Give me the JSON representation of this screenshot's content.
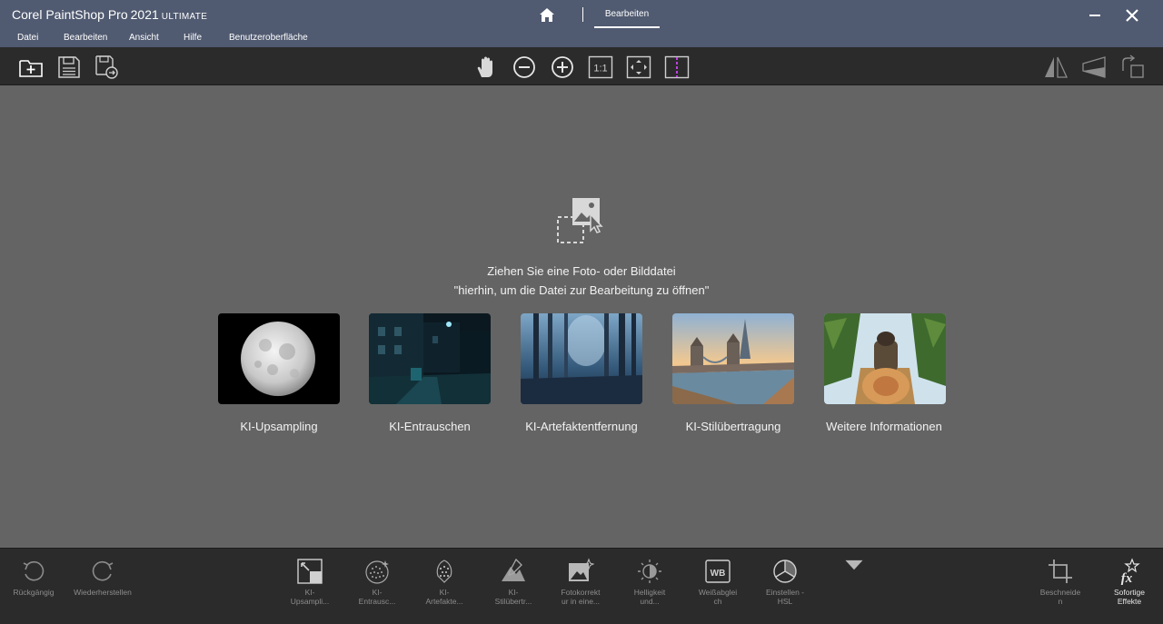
{
  "titlebar": {
    "app_name": "Corel PaintShop Pro",
    "year": "2021",
    "edition": "ULTIMATE",
    "active_tab": "Bearbeiten"
  },
  "menu": {
    "items": [
      "Datei",
      "Bearbeiten",
      "Ansicht",
      "Hilfe",
      "Benutzeroberfläche"
    ]
  },
  "toolbar": {
    "left": [
      "new-icon",
      "save-icon",
      "save-as-icon"
    ],
    "center": [
      "pan-icon",
      "zoom-out-icon",
      "zoom-in-icon",
      "actual-size-icon",
      "fit-icon",
      "compare-icon"
    ],
    "right": [
      "flip-icon",
      "perspective-icon",
      "rotate-icon"
    ],
    "actual_size_text": "1:1"
  },
  "workspace": {
    "drop_line1": "Ziehen Sie eine Foto- oder Bilddatei",
    "drop_line2": "\"hierhin, um die Datei zur Bearbeitung zu öffnen\"",
    "cards": [
      {
        "label": "KI-Upsampling"
      },
      {
        "label": "KI-Entrauschen"
      },
      {
        "label": "KI-Artefaktentfernung"
      },
      {
        "label": "KI-Stilübertragung"
      },
      {
        "label": "Weitere Informationen"
      }
    ]
  },
  "bottombar": {
    "undo": {
      "line1": "Rückgängig"
    },
    "redo": {
      "line1": "Wiederherstellen"
    },
    "tools": [
      {
        "line1": "KI-",
        "line2": "Upsampli..."
      },
      {
        "line1": "KI-",
        "line2": "Entrausc..."
      },
      {
        "line1": "KI-",
        "line2": "Artefakte..."
      },
      {
        "line1": "KI-",
        "line2": "Stilübertr..."
      },
      {
        "line1": "Fotokorrekt",
        "line2": "ur in eine..."
      },
      {
        "line1": "Helligkeit",
        "line2": "und..."
      },
      {
        "line1": "Weißabglei",
        "line2": "ch"
      },
      {
        "line1": "Einstellen -",
        "line2": "HSL"
      }
    ],
    "wb_text": "WB",
    "crop": {
      "line1": "Beschneide",
      "line2": "n"
    },
    "effects": {
      "line1": "Sofortige",
      "line2": "Effekte"
    }
  },
  "colors": {
    "titlebar": "#505a70",
    "toolbar": "#2b2b2b",
    "workspace": "#646464",
    "compare_accent": "#c040e0"
  }
}
